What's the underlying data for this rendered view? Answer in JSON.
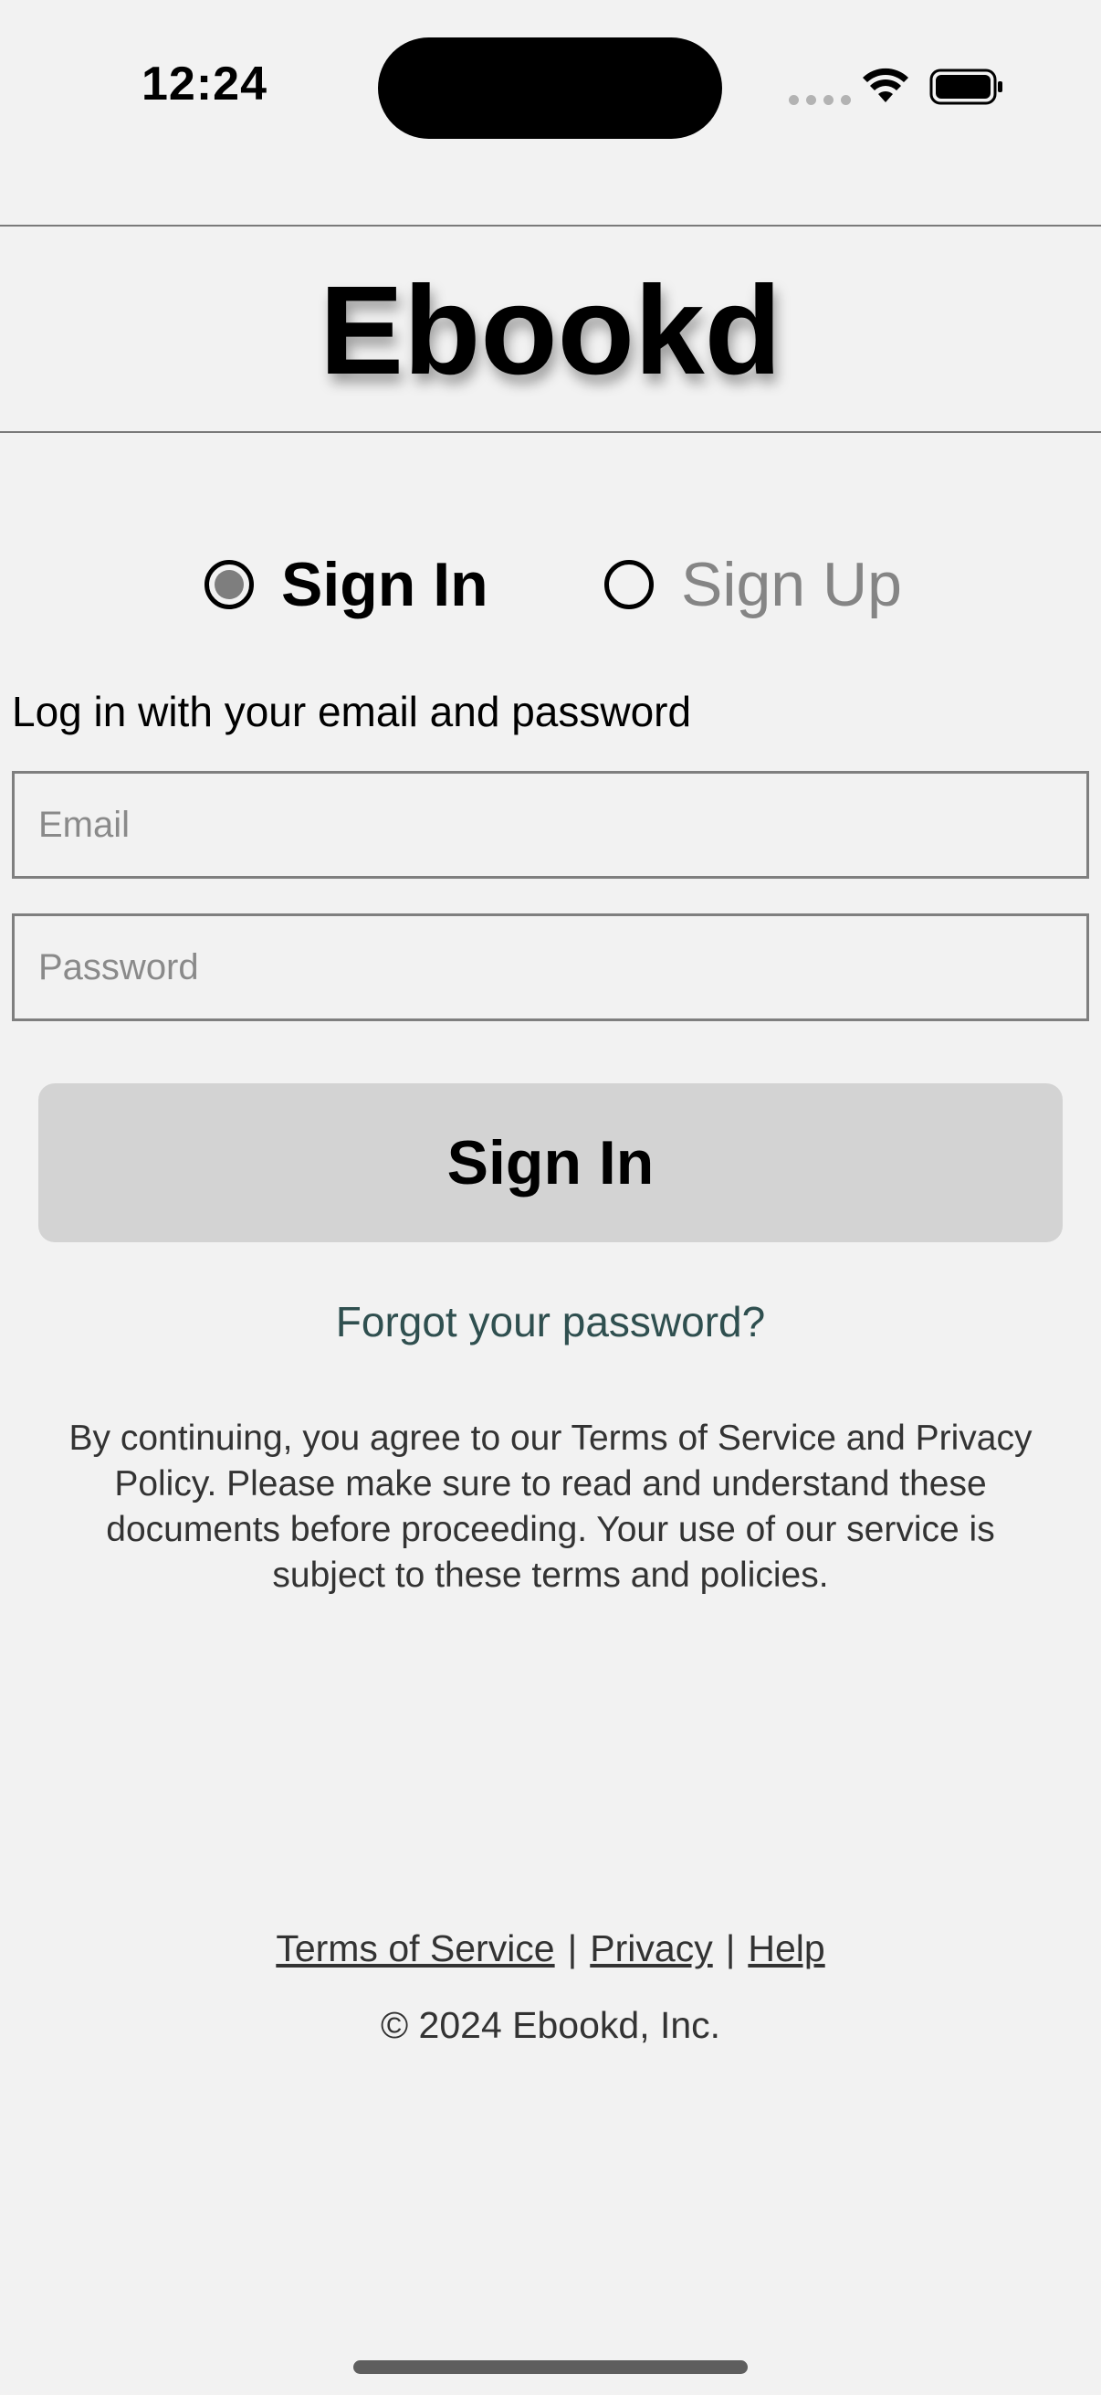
{
  "status_bar": {
    "time": "12:24",
    "icons": [
      "signal-dots-icon",
      "wifi-icon",
      "battery-icon"
    ]
  },
  "header": {
    "title": "Ebookd"
  },
  "auth_mode": {
    "selected": "sign_in",
    "sign_in_label": "Sign In",
    "sign_up_label": "Sign Up"
  },
  "form": {
    "instructions": "Log in with your email and password",
    "email_placeholder": "Email",
    "email_value": "",
    "password_placeholder": "Password",
    "password_value": "",
    "submit_label": "Sign In",
    "forgot_password_label": "Forgot your password?"
  },
  "legal": {
    "text": "By continuing, you agree to our Terms of Service and Privacy Policy. Please make sure to read and understand these documents before proceeding. Your use of our service is subject to these terms and policies."
  },
  "footer": {
    "links": [
      "Terms of Service",
      "Privacy",
      "Help"
    ],
    "separator": "|",
    "copyright": "© 2024 Ebookd, Inc."
  },
  "colors": {
    "background": "#f2f2f2",
    "button_bg": "#d3d3d3",
    "link": "#2f4f4f",
    "inactive_text": "#858585"
  }
}
